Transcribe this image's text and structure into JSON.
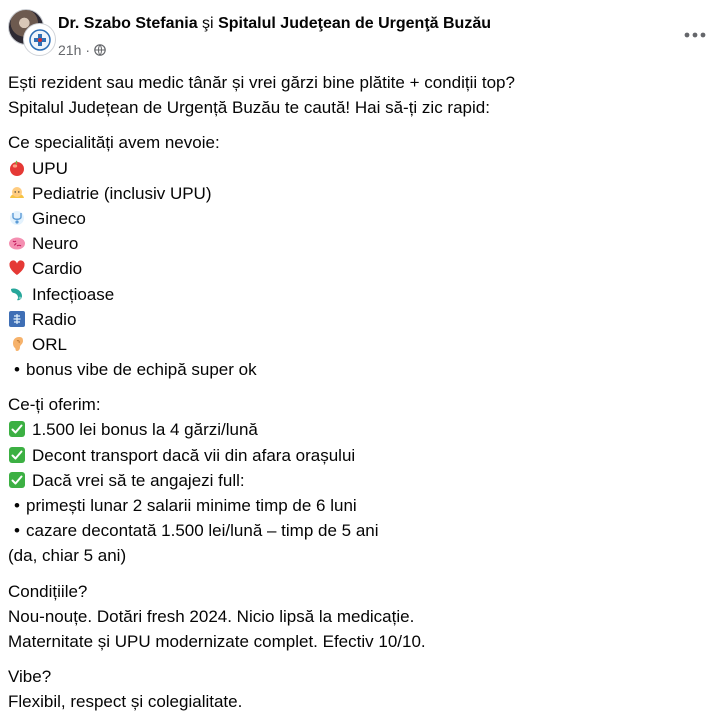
{
  "post": {
    "author": "Dr. Szabo Stefania",
    "separator": "şi",
    "page": "Spitalul Judeţean de Urgenţă Buzău",
    "time": "21h",
    "dot": "·"
  },
  "intro": [
    "Ești rezident sau medic tânăr și vrei gărzi bine plătite + condiții top?",
    "Spitalul Județean de Urgență Buzău te caută! Hai să-ți zic rapid:"
  ],
  "specialties_title": "Ce specialități avem nevoie:",
  "specialties": [
    {
      "label": "UPU",
      "icon": "red-orb-icon"
    },
    {
      "label": "Pediatrie (inclusiv UPU)",
      "icon": "baby-icon"
    },
    {
      "label": "Gineco",
      "icon": "stethoscope-icon"
    },
    {
      "label": "Neuro",
      "icon": "brain-icon"
    },
    {
      "label": "Cardio",
      "icon": "heart-icon"
    },
    {
      "label": "Infecțioase",
      "icon": "microbe-icon"
    },
    {
      "label": "Radio",
      "icon": "xray-icon"
    },
    {
      "label": "ORL",
      "icon": "ear-icon"
    },
    {
      "label": "bonus vibe de echipă super ok",
      "icon": "bullet"
    }
  ],
  "offer_title": "Ce-ți oferim:",
  "offers": [
    {
      "label": "1.500 lei bonus la 4 gărzi/lună",
      "icon": "check-icon"
    },
    {
      "label": "Decont transport dacă vii din afara orașului",
      "icon": "check-icon"
    },
    {
      "label": "Dacă vrei să te angajezi full:",
      "icon": "check-icon"
    },
    {
      "label": "primești lunar 2 salarii minime timp de 6 luni",
      "icon": "bullet"
    },
    {
      "label": "cazare decontată 1.500 lei/lună – timp de 5 ani",
      "icon": "bullet"
    },
    {
      "label": "(da, chiar 5 ani)",
      "icon": "none"
    }
  ],
  "conditions": [
    "Condițiile?",
    "Nou-nouțe. Dotări fresh 2024. Nicio lipsă la medicație.",
    "Maternitate și UPU modernizate complet. Efectiv 10/10."
  ],
  "vibe": [
    "Vibe?",
    "Flexibil, respect și colegialitate."
  ],
  "colors": {
    "text": "#050505",
    "secondary": "#65676b",
    "check_green": "#3cb043"
  }
}
